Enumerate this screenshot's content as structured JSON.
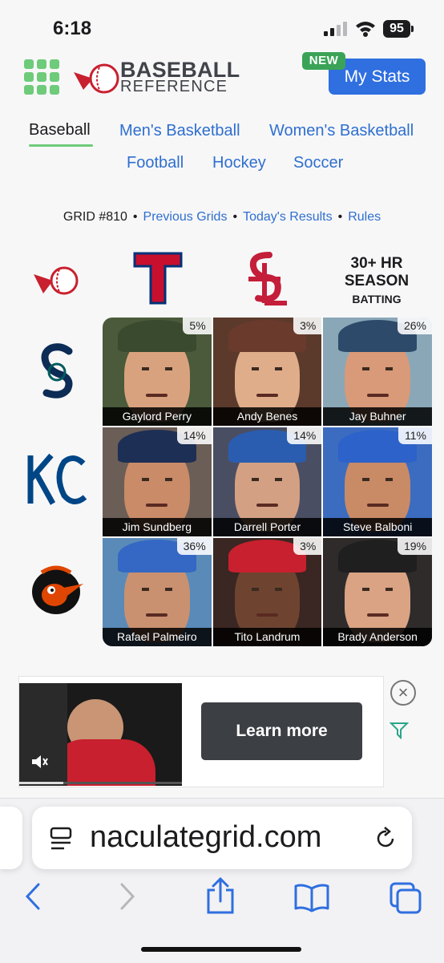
{
  "status": {
    "time": "6:18",
    "battery": "95"
  },
  "header": {
    "logo_line1": "BASEBALL",
    "logo_line2": "REFERENCE",
    "new_badge": "NEW",
    "my_stats": "My Stats"
  },
  "sports_nav": [
    {
      "label": "Baseball",
      "active": true
    },
    {
      "label": "Men's Basketball"
    },
    {
      "label": "Women's Basketball"
    },
    {
      "label": "Football"
    },
    {
      "label": "Hockey"
    },
    {
      "label": "Soccer"
    }
  ],
  "grid_bar": {
    "grid": "GRID #810",
    "previous": "Previous Grids",
    "today": "Today's Results",
    "rules": "Rules",
    "separator": "•"
  },
  "columns": [
    {
      "icon": "rangers-logo-icon",
      "letter": "T",
      "color": "#c8102e"
    },
    {
      "icon": "cardinals-logo-icon",
      "letter": "StL",
      "color": "#c41e3a"
    },
    {
      "line1": "30+ HR",
      "line2": "SEASON",
      "line3": "BATTING"
    }
  ],
  "rows": [
    {
      "icon": "mariners-logo-icon",
      "letter": "S",
      "color": "#0c2c56"
    },
    {
      "icon": "royals-logo-icon",
      "letter": "KC",
      "color": "#004687"
    },
    {
      "icon": "orioles-logo-icon",
      "color": "#df4601"
    }
  ],
  "cells": [
    {
      "name": "Gaylord Perry",
      "pct": "5%",
      "bg": "#4a5a3a",
      "skin": "#d9a27e",
      "cap": "#3a4a2e"
    },
    {
      "name": "Andy Benes",
      "pct": "3%",
      "bg": "#5b3a2c",
      "skin": "#e0ad8a",
      "cap": "#6a3a2c"
    },
    {
      "name": "Jay Buhner",
      "pct": "26%",
      "bg": "#8aa7b8",
      "skin": "#d89a78",
      "cap": "#2d4a6b"
    },
    {
      "name": "Jim Sundberg",
      "pct": "14%",
      "bg": "#6b5e56",
      "skin": "#c98b68",
      "cap": "#1d2f55"
    },
    {
      "name": "Darrell Porter",
      "pct": "14%",
      "bg": "#4a4e62",
      "skin": "#d3a083",
      "cap": "#2a5db0"
    },
    {
      "name": "Steve Balboni",
      "pct": "11%",
      "bg": "#3c6cc0",
      "skin": "#c98a66",
      "cap": "#2c62c9"
    },
    {
      "name": "Rafael Palmeiro",
      "pct": "36%",
      "bg": "#5a8ab8",
      "skin": "#c99170",
      "cap": "#3468c4"
    },
    {
      "name": "Tito Landrum",
      "pct": "3%",
      "bg": "#3a2622",
      "skin": "#6e4430",
      "cap": "#c8202e"
    },
    {
      "name": "Brady Anderson",
      "pct": "19%",
      "bg": "#2e2b2a",
      "skin": "#d9a384",
      "cap": "#1f1f1f"
    }
  ],
  "ad": {
    "cta": "Learn more",
    "close_icon": "close-icon",
    "brand_icon": "adchoices-icon"
  },
  "safari": {
    "url": "naculategrid.com"
  }
}
